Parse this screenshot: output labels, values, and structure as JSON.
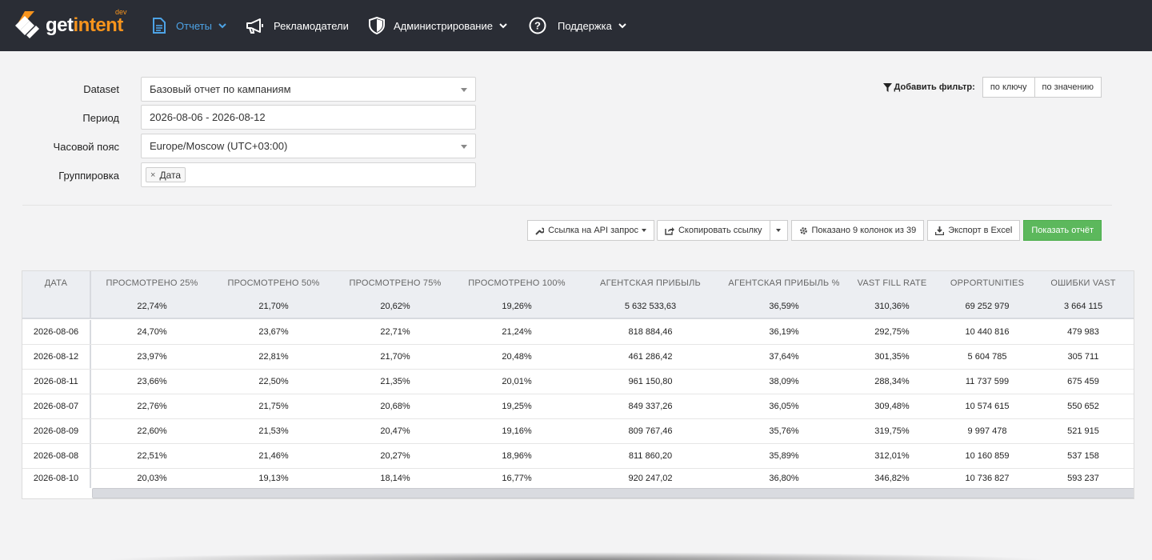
{
  "brand": {
    "name_part1": "get",
    "name_part2": "intent",
    "badge": "dev",
    "accent_color": "#f7941d"
  },
  "nav": {
    "reports": "Отчеты",
    "advertisers": "Рекламодатели",
    "admin": "Администрирование",
    "support": "Поддержка"
  },
  "form": {
    "dataset_label": "Dataset",
    "dataset_value": "Базовый отчет по кампаниям",
    "period_label": "Период",
    "period_value": "2026-08-06 - 2026-08-12",
    "timezone_label": "Часовой пояс",
    "timezone_value": "Europe/Moscow (UTC+03:00)",
    "grouping_label": "Группировка",
    "grouping_tag": "Дата",
    "grouping_tag_remove": "×"
  },
  "filter": {
    "label": "Добавить фильтр:",
    "by_key": "по ключу",
    "by_value": "по значению"
  },
  "toolbar": {
    "api_link": "Ссылка на API запрос",
    "copy_link": "Скопировать ссылку",
    "columns_shown": "Показано 9 колонок из 39",
    "export_excel": "Экспорт в Excel",
    "show_report": "Показать отчёт"
  },
  "table": {
    "headers": [
      "Дата",
      "Просмотрено 25%",
      "Просмотрено 50%",
      "Просмотрено 75%",
      "Просмотрено 100%",
      "Агентская прибыль",
      "Агентская прибыль %",
      "VAST fill rate",
      "Opportunities",
      "Ошибки VAST"
    ],
    "totals": [
      "",
      "22,74%",
      "21,70%",
      "20,62%",
      "19,26%",
      "5 632 533,63",
      "36,59%",
      "310,36%",
      "69 252 979",
      "3 664 115"
    ],
    "rows": [
      [
        "2026-08-06",
        "24,70%",
        "23,67%",
        "22,71%",
        "21,24%",
        "818 884,46",
        "36,19%",
        "292,75%",
        "10 440 816",
        "479 983"
      ],
      [
        "2026-08-12",
        "23,97%",
        "22,81%",
        "21,70%",
        "20,48%",
        "461 286,42",
        "37,64%",
        "301,35%",
        "5 604 785",
        "305 711"
      ],
      [
        "2026-08-11",
        "23,66%",
        "22,50%",
        "21,35%",
        "20,01%",
        "961 150,80",
        "38,09%",
        "288,34%",
        "11 737 599",
        "675 459"
      ],
      [
        "2026-08-07",
        "22,76%",
        "21,75%",
        "20,68%",
        "19,25%",
        "849 337,26",
        "36,05%",
        "309,48%",
        "10 574 615",
        "550 652"
      ],
      [
        "2026-08-09",
        "22,60%",
        "21,53%",
        "20,47%",
        "19,16%",
        "809 767,46",
        "35,76%",
        "319,75%",
        "9 997 478",
        "521 915"
      ],
      [
        "2026-08-08",
        "22,51%",
        "21,46%",
        "20,27%",
        "18,96%",
        "811 860,20",
        "35,89%",
        "312,01%",
        "10 160 859",
        "537 158"
      ],
      [
        "2026-08-10",
        "20,03%",
        "19,13%",
        "18,14%",
        "16,77%",
        "920 247,02",
        "36,80%",
        "346,82%",
        "10 736 827",
        "593 237"
      ]
    ]
  },
  "icons": {
    "reports": "document-icon",
    "advertisers": "megaphone-icon",
    "admin": "shield-icon",
    "support": "question-circle-icon",
    "filter": "funnel-icon",
    "api": "wrench-icon",
    "copy": "share-icon",
    "columns": "gear-icon",
    "export": "download-icon"
  }
}
